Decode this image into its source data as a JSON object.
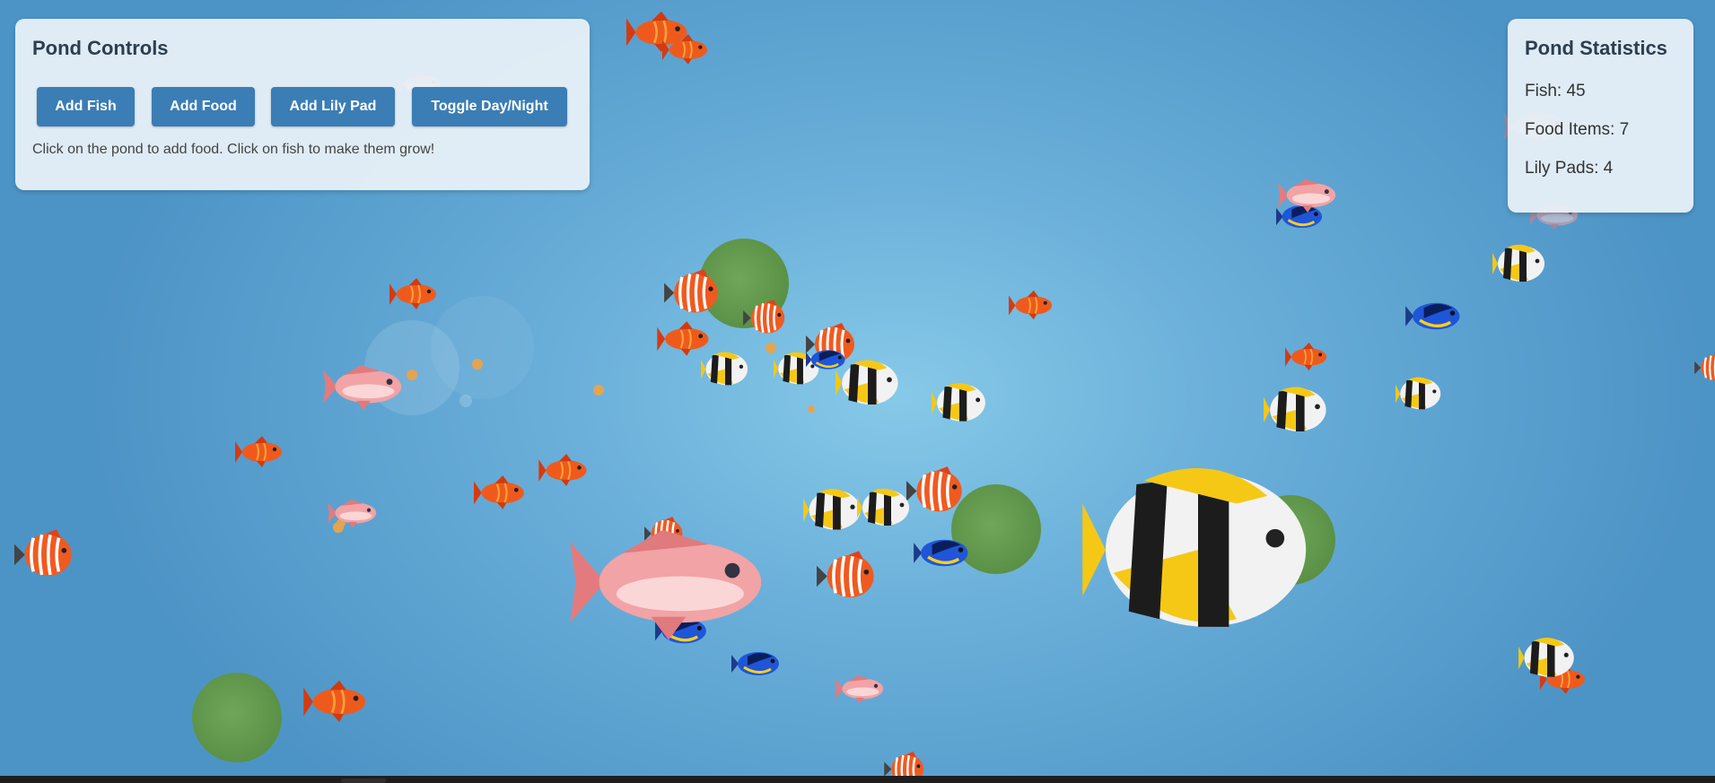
{
  "controls": {
    "title": "Pond Controls",
    "buttons": {
      "add_fish": "Add Fish",
      "add_food": "Add Food",
      "add_lily_pad": "Add Lily Pad",
      "toggle_day_night": "Toggle Day/Night"
    },
    "hint": "Click on the pond to add food. Click on fish to make them grow!"
  },
  "stats": {
    "title": "Pond Statistics",
    "fish_label": "Fish: 45",
    "food_label": "Food Items: 7",
    "lily_label": "Lily Pads: 4"
  },
  "colors": {
    "button": "#3b7db5",
    "lily_pad": "#5a9146",
    "food": "#e4a450",
    "water_light": "#86c9e8",
    "water_dark": "#4d94c6"
  },
  "fish_species": [
    "goldfish-icon",
    "clownfish-icon",
    "butterflyfish-icon",
    "blue-tang-icon",
    "red-snapper-icon"
  ]
}
